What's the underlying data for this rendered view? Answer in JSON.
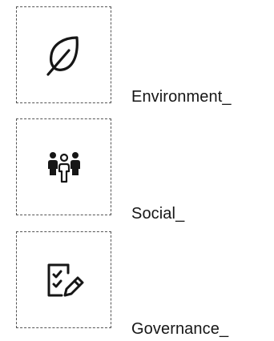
{
  "categories": [
    {
      "label": "Environment_",
      "icon": "leaf-icon"
    },
    {
      "label": "Social_",
      "icon": "people-group-icon"
    },
    {
      "label": "Governance_",
      "icon": "checklist-edit-icon"
    }
  ],
  "colors": {
    "text": "#161616",
    "icon": "#161616",
    "dashed_border": "#555555",
    "background": "#ffffff"
  }
}
